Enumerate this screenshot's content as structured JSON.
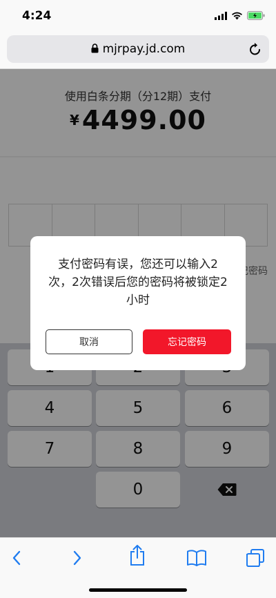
{
  "status_bar": {
    "time": "4:24"
  },
  "browser": {
    "url": "mjrpay.jd.com"
  },
  "payment": {
    "title": "使用白条分期（分12期）支付",
    "currency_symbol": "¥",
    "amount": "4499.00",
    "forgot_password_link": "忘记密码"
  },
  "keypad": {
    "keys": [
      "1",
      "2",
      "3",
      "4",
      "5",
      "6",
      "7",
      "8",
      "9",
      "0"
    ]
  },
  "dialog": {
    "message": "支付密码有误，您还可以输入2次，2次错误后您的密码将被锁定2小时",
    "cancel_label": "取消",
    "forgot_label": "忘记密码"
  },
  "colors": {
    "accent": "#f2172a",
    "ios_blue": "#1f7cf0"
  }
}
